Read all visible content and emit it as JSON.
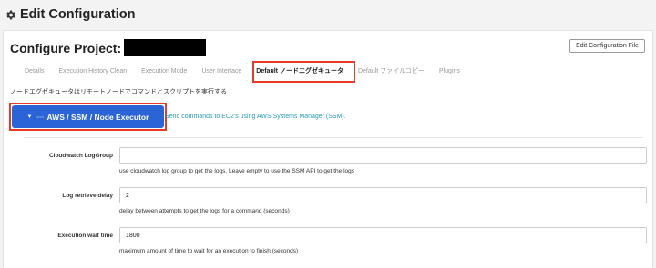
{
  "page": {
    "title": "Edit Configuration"
  },
  "header": {
    "project_label": "Configure Project:",
    "config_file_button": "Edit Configuration File"
  },
  "tabs": [
    {
      "label": "Details"
    },
    {
      "label": "Execution History Clean"
    },
    {
      "label": "Execution Mode"
    },
    {
      "label": "User Interface"
    },
    {
      "label": "Default ノードエグゼキュータ",
      "active": true
    },
    {
      "label": "Default ファイルコピー"
    },
    {
      "label": "Plugins"
    }
  ],
  "section": {
    "description": "ノードエグゼキュータはリモートノードでコマンドとスクリプトを実行する",
    "executor_label": "AWS / SSM / Node Executor",
    "executor_description": "Send commands to EC2's using AWS Systems Manager (SSM)."
  },
  "fields": [
    {
      "label": "Cloudwatch LogGroup",
      "value": "",
      "help": "use cloudwatch log group to get the logs. Leave empty to use the SSM API to get the logs"
    },
    {
      "label": "Log retrieve delay",
      "value": "2",
      "help": "delay between attempts to get the logs for a command (seconds)"
    },
    {
      "label": "Execution wait time",
      "value": "1800",
      "help": "maximum amount of time to wait for an execution to finish (seconds)"
    }
  ],
  "colors": {
    "primary": "#2a64d6",
    "highlight": "#e53a2c",
    "link": "#2a9bb7"
  }
}
